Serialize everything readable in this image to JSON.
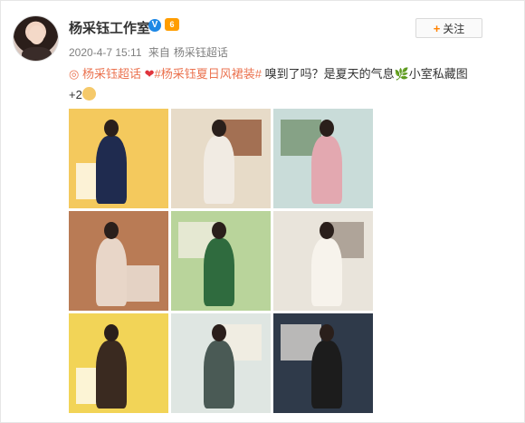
{
  "post": {
    "user_name": "杨采钰工作室",
    "verify_mark": "V",
    "vip_level": "6",
    "date": "2020-4-7 15:11",
    "source_prefix": "来自",
    "source": "杨采钰超话",
    "follow_label": "关注",
    "follow_icon": "+",
    "text_parts": {
      "topic1_icon": "◎",
      "topic1": "杨采钰超话",
      "heart": "❤",
      "topic2": "#杨采钰夏日风裙装#",
      "body1": " 嗅到了吗？是夏天的气息",
      "leaf": "🌿",
      "body2": "小室私藏图",
      "suffix": "+2"
    }
  },
  "photos": [
    {
      "name": "photo-1",
      "bg": "#f4c95d",
      "accent": "#1f2b4f",
      "accent2": "#ffffff"
    },
    {
      "name": "photo-2",
      "bg": "#e7dbc8",
      "accent": "#f1ebe3",
      "accent2": "#8c4c2c"
    },
    {
      "name": "photo-3",
      "bg": "#c9dcd9",
      "accent": "#e3a8b0",
      "accent2": "#6f8f6a"
    },
    {
      "name": "photo-4",
      "bg": "#b97b55",
      "accent": "#e8d6c8",
      "accent2": "#f3efe9"
    },
    {
      "name": "photo-5",
      "bg": "#b9d49b",
      "accent": "#2f6b3e",
      "accent2": "#f4efe4"
    },
    {
      "name": "photo-6",
      "bg": "#e9e4db",
      "accent": "#f7f3ec",
      "accent2": "#9b8f83"
    },
    {
      "name": "photo-7",
      "bg": "#f2d457",
      "accent": "#3a2a20",
      "accent2": "#ffffff"
    },
    {
      "name": "photo-8",
      "bg": "#dfe6e2",
      "accent": "#4a5a55",
      "accent2": "#f5efe2"
    },
    {
      "name": "photo-9",
      "bg": "#2f3a4a",
      "accent": "#1c1c1c",
      "accent2": "#e8e3dc"
    }
  ]
}
